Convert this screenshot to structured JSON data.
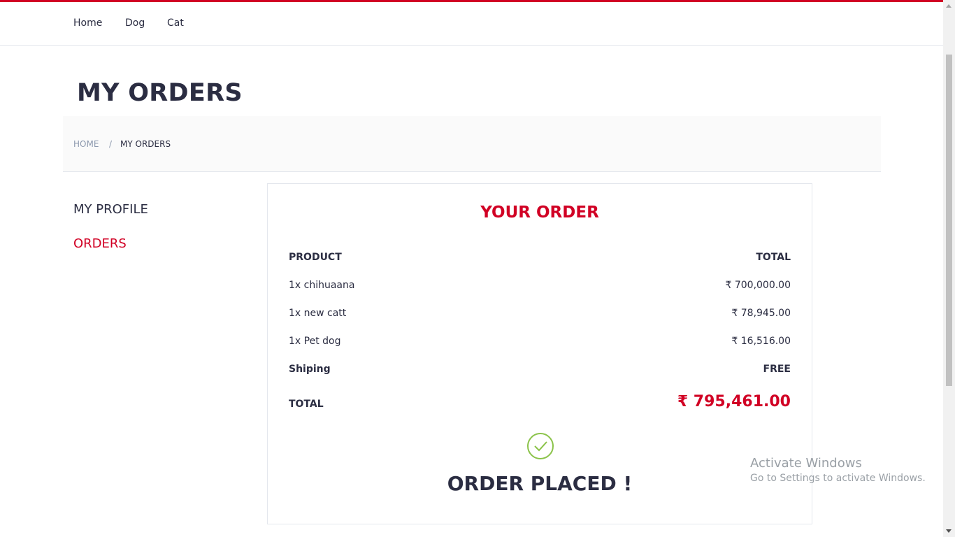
{
  "colors": {
    "accent": "#d10024",
    "dark": "#2b2d42",
    "muted": "#8d99ae",
    "check": "#8bc34a"
  },
  "nav": {
    "items": [
      {
        "label": "Home"
      },
      {
        "label": "Dog"
      },
      {
        "label": "Cat"
      }
    ]
  },
  "page": {
    "title": "MY ORDERS"
  },
  "breadcrumb": {
    "home": "HOME",
    "separator": "/",
    "current": "MY ORDERS"
  },
  "sidebar": {
    "items": [
      {
        "label": "MY PROFILE"
      },
      {
        "label": "ORDERS"
      }
    ]
  },
  "order": {
    "heading": "YOUR ORDER",
    "header": {
      "product": "PRODUCT",
      "total": "TOTAL"
    },
    "items": [
      {
        "name": "1x chihuaana",
        "price": "₹ 700,000.00"
      },
      {
        "name": "1x new catt",
        "price": "₹ 78,945.00"
      },
      {
        "name": "1x Pet dog",
        "price": "₹ 16,516.00"
      }
    ],
    "shipping": {
      "label": "Shiping",
      "value": "FREE"
    },
    "total": {
      "label": "TOTAL",
      "value": "₹ 795,461.00"
    },
    "status_icon": "check-circle-icon",
    "status": "ORDER PLACED !"
  },
  "watermark": {
    "title": "Activate Windows",
    "subtitle": "Go to Settings to activate Windows."
  }
}
